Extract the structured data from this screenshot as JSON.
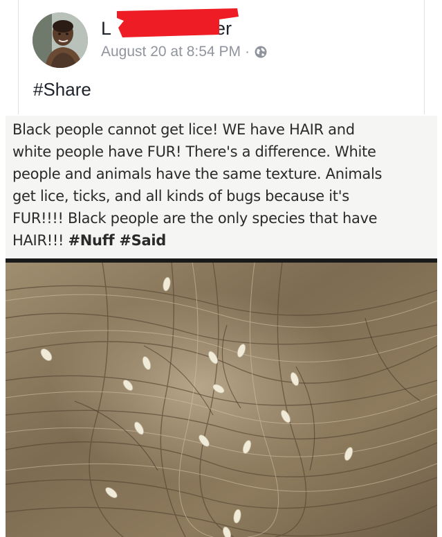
{
  "post": {
    "author_visible": "L                              er",
    "author_start": "L",
    "author_end": "er",
    "timestamp": "August 20 at 8:54 PM",
    "separator": "·",
    "privacy_icon": "globe-icon",
    "text": "#Share"
  },
  "shared_image": {
    "caption_lines": [
      {
        "text": "Black people cannot get lice! WE have HAIR and",
        "tags": ""
      },
      {
        "text": "white people have FUR! There's a difference. White",
        "tags": ""
      },
      {
        "text": "people and animals have the same texture. Animals",
        "tags": ""
      },
      {
        "text": "get lice, ticks, and all kinds of bugs because it's",
        "tags": ""
      },
      {
        "text": "FUR!!!! Black people are the only species that have",
        "tags": ""
      },
      {
        "text": "HAIR!!! ",
        "tags": "#Nuff #Said"
      }
    ]
  },
  "colors": {
    "redaction": "#ee1c25",
    "name_text": "#1d2129",
    "meta_text": "#90949c",
    "caption_bg": "#f5f5f3",
    "hair_base": "#8b7a5e"
  }
}
